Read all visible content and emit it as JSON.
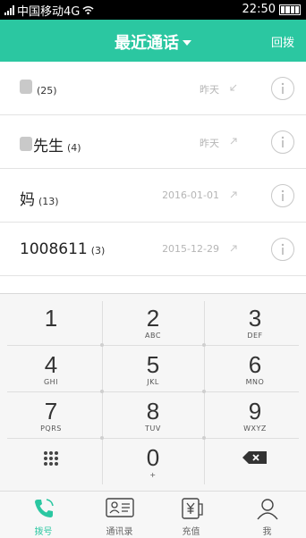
{
  "status_bar": {
    "carrier": "中国移动4G",
    "clock": "22:50",
    "icons": [
      "signal-icon",
      "wifi-icon",
      "battery-icon"
    ]
  },
  "header": {
    "title": "最近通话",
    "action": "回拨",
    "color": "#2bc7a1"
  },
  "calls": [
    {
      "name": "",
      "count": "(25)",
      "date": "昨天",
      "direction": "incoming-call-icon"
    },
    {
      "name": "先生",
      "count": "(4)",
      "date": "昨天",
      "direction": "outgoing-call-icon"
    },
    {
      "name": "妈",
      "count": "(13)",
      "date": "2016-01-01",
      "direction": "outgoing-call-icon"
    },
    {
      "name": "1008611",
      "count": "(3)",
      "date": "2015-12-29",
      "direction": "outgoing-call-icon"
    }
  ],
  "dialpad": {
    "keys": [
      {
        "digit": "1",
        "letters": ""
      },
      {
        "digit": "2",
        "letters": "ABC"
      },
      {
        "digit": "3",
        "letters": "DEF"
      },
      {
        "digit": "4",
        "letters": "GHI"
      },
      {
        "digit": "5",
        "letters": "JKL"
      },
      {
        "digit": "6",
        "letters": "MNO"
      },
      {
        "digit": "7",
        "letters": "PQRS"
      },
      {
        "digit": "8",
        "letters": "TUV"
      },
      {
        "digit": "9",
        "letters": "WXYZ"
      },
      {
        "digit": "0",
        "letters": "+"
      }
    ],
    "special_keys": [
      "dialpad-grid-icon",
      "backspace-icon"
    ]
  },
  "bottom_nav": {
    "items": [
      {
        "label": "拨号",
        "icon": "phone-icon",
        "active": true
      },
      {
        "label": "通讯录",
        "icon": "contacts-icon",
        "active": false
      },
      {
        "label": "充值",
        "icon": "recharge-icon",
        "active": false
      },
      {
        "label": "我",
        "icon": "profile-icon",
        "active": false
      }
    ]
  }
}
